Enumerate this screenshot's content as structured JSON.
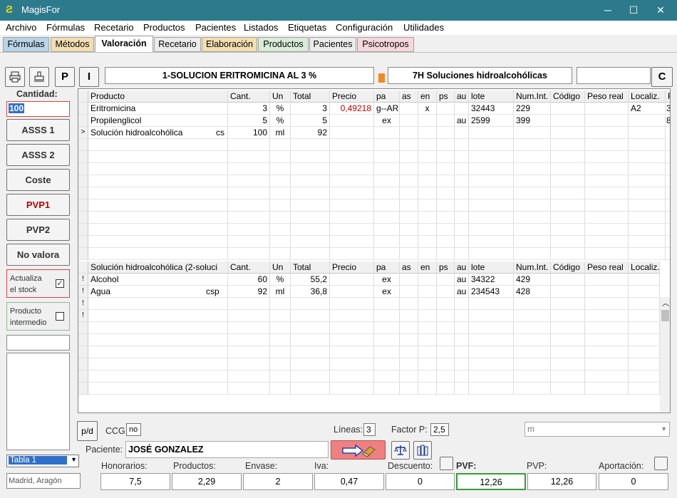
{
  "window": {
    "title": "MagisFor"
  },
  "menu": [
    "Archivo",
    "Fórmulas",
    "Recetario",
    "Productos",
    "Pacientes",
    "Listados",
    "Etiquetas",
    "Configuración",
    "Utilidades"
  ],
  "tabs": [
    "Fórmulas",
    "Métodos",
    "Valoración",
    "Recetario",
    "Elaboración",
    "Productos",
    "Pacientes",
    "Psicotropos"
  ],
  "header": {
    "formula_name": "1-SOLUCION ERITROMICINA AL 3 %",
    "method_name": "7H Soluciones hidroalcohólicas",
    "btn_p": "P",
    "btn_i": "I",
    "btn_c": "C"
  },
  "left": {
    "cantidad_label": "Cantidad:",
    "cantidad_value": "100",
    "buttons": [
      "ASSS 1",
      "ASSS 2",
      "Coste",
      "PVP1",
      "PVP2",
      "No valora"
    ],
    "actualiza_label_1": "Actualiza",
    "actualiza_label_2": "el stock",
    "actualiza_checked": "✓",
    "intermedio_label_1": "Producto",
    "intermedio_label_2": "intermedio",
    "tabla_select": "Tabla 1",
    "region": "Madrid, Aragón"
  },
  "grid1": {
    "headers": [
      "Producto",
      "Cant.",
      "Un",
      "Total",
      "Precio",
      "pa",
      "as",
      "en",
      "ps",
      "au",
      "lote",
      "Num.Int.",
      "Código",
      "Peso real",
      "Localiz.",
      "F"
    ],
    "rows": [
      {
        "ind": "",
        "producto": "Eritromicina",
        "extra": "",
        "cant": "3",
        "un": "%",
        "total": "3",
        "precio": "0,49218",
        "pa": "g--AR",
        "as": "",
        "en": "x",
        "ps": "",
        "au": "",
        "lote": "32443",
        "numint": "229",
        "codigo": "",
        "peso": "",
        "localiz": "A2",
        "f": "3"
      },
      {
        "ind": "",
        "producto": "Propilenglicol",
        "extra": "",
        "cant": "5",
        "un": "%",
        "total": "5",
        "precio": "",
        "pa": "ex",
        "as": "",
        "en": "",
        "ps": "",
        "au": "au",
        "lote": "2599",
        "numint": "399",
        "codigo": "",
        "peso": "",
        "localiz": "",
        "f": "8"
      },
      {
        "ind": ">",
        "producto": "Solución hidroalcohólica",
        "extra": "cs",
        "cant": "100",
        "un": "ml",
        "total": "92",
        "precio": "",
        "pa": "",
        "as": "",
        "en": "",
        "ps": "",
        "au": "",
        "lote": "",
        "numint": "",
        "codigo": "",
        "peso": "",
        "localiz": "",
        "f": ""
      }
    ]
  },
  "grid2": {
    "headers": [
      "Solución hidroalcohólica (2-soluci",
      "Cant.",
      "Un",
      "Total",
      "Precio",
      "pa",
      "as",
      "en",
      "ps",
      "au",
      "lote",
      "Num.Int.",
      "Código",
      "Peso real",
      "Localiz."
    ],
    "rows": [
      {
        "ind": "!",
        "producto": "Alcohol",
        "extra": "",
        "cant": "60",
        "un": "%",
        "total": "55,2",
        "precio": "",
        "pa": "ex",
        "au": "au",
        "lote": "34322",
        "numint": "429"
      },
      {
        "ind": "!",
        "producto": "Agua",
        "extra": "csp",
        "cant": "92",
        "un": "ml",
        "total": "36,8",
        "precio": "",
        "pa": "ex",
        "au": "au",
        "lote": "234543",
        "numint": "428"
      },
      {
        "ind": "!",
        "producto": "",
        "extra": "",
        "cant": "",
        "un": "",
        "total": "",
        "precio": "",
        "pa": "",
        "au": "",
        "lote": "",
        "numint": ""
      },
      {
        "ind": "!",
        "producto": "",
        "extra": "",
        "cant": "",
        "un": "",
        "total": "",
        "precio": "",
        "pa": "",
        "au": "",
        "lote": "",
        "numint": ""
      }
    ]
  },
  "bottom": {
    "pd_label": "p/d",
    "ccg_label": "CCG:",
    "ccg_value": "no",
    "lineas_label": "Líneas:",
    "lineas_value": "3",
    "factor_label": "Factor P:",
    "factor_value": "2,5",
    "unit_select": "m",
    "paciente_label": "Paciente:",
    "paciente_value": "JOSÉ GONZALEZ",
    "totals_labels": [
      "Honorarios:",
      "Productos:",
      "Envase:",
      "Iva:",
      "Descuento:",
      "PVF:",
      "PVP:",
      "Aportación:"
    ],
    "totals_values": [
      "7,5",
      "2,29",
      "2",
      "0,47",
      "0",
      "12,26",
      "12,26",
      "0"
    ]
  }
}
